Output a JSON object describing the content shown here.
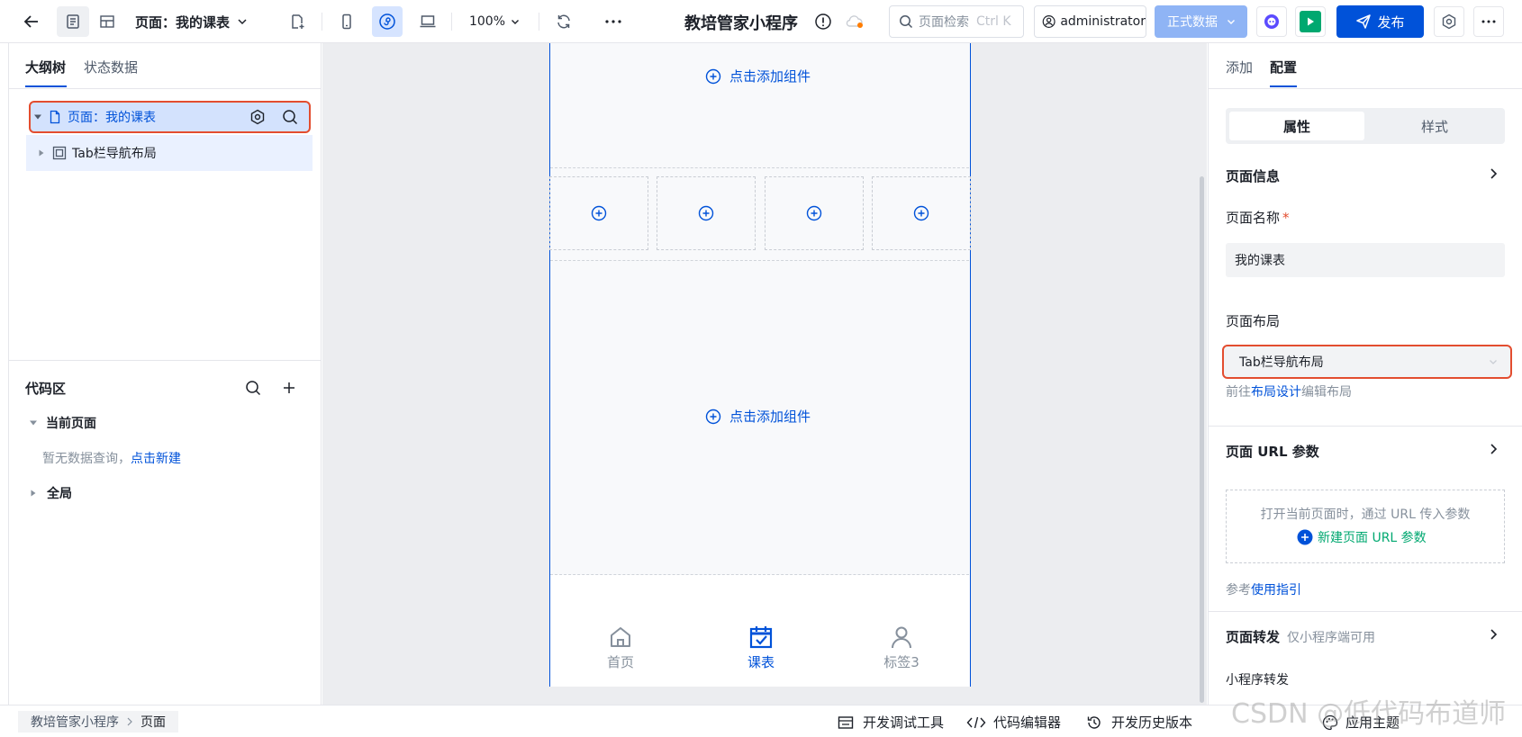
{
  "topbar": {
    "page_selector": "页面：我的课表",
    "zoom": "100%",
    "app_title": "教培管家小程序",
    "search_placeholder": "页面检索",
    "search_shortcut": "Ctrl K",
    "user": "administrator",
    "env": "正式数据",
    "publish": "发布"
  },
  "left": {
    "tabs": [
      "大纲树",
      "状态数据"
    ],
    "tree": [
      {
        "label": "页面：我的课表"
      },
      {
        "label": "Tab栏导航布局"
      }
    ],
    "code_title": "代码区",
    "current_page": "当前页面",
    "empty_text": "暂无数据查询，",
    "new_link": "点击新建",
    "global": "全局"
  },
  "canvas": {
    "add_component": "点击添加组件",
    "tabbar": [
      {
        "label": "首页",
        "icon": "home-icon",
        "active": false
      },
      {
        "label": "课表",
        "icon": "calendar-check-icon",
        "active": true
      },
      {
        "label": "标签3",
        "icon": "user-icon",
        "active": false
      }
    ]
  },
  "right": {
    "tabs": [
      "添加",
      "配置"
    ],
    "segments": [
      "属性",
      "样式"
    ],
    "page_info": "页面信息",
    "page_name_label": "页面名称",
    "required_mark": "*",
    "page_name_value": "我的课表",
    "layout_label": "页面布局",
    "layout_value": "Tab栏导航布局",
    "layout_hint_prefix": "前往",
    "layout_hint_link": "布局设计",
    "layout_hint_suffix": "编辑布局",
    "url_params_title": "页面 URL 参数",
    "url_params_desc": "打开当前页面时，通过 URL 传入参数",
    "url_params_new": "新建页面 URL 参数",
    "guide_prefix": "参考",
    "guide_link": "使用指引",
    "forward_title": "页面转发",
    "forward_hint": "仅小程序端可用",
    "mini_forward": "小程序转发"
  },
  "footer": {
    "breadcrumb": [
      "教培管家小程序",
      "页面"
    ],
    "dev_tools": "开发调试工具",
    "code_editor": "代码编辑器",
    "history": "开发历史版本",
    "theme": "应用主题"
  },
  "watermark": "CSDN @低代码布道师",
  "colors": {
    "primary": "#0052d9",
    "highlight": "#e34d2f",
    "green": "#00a870"
  }
}
